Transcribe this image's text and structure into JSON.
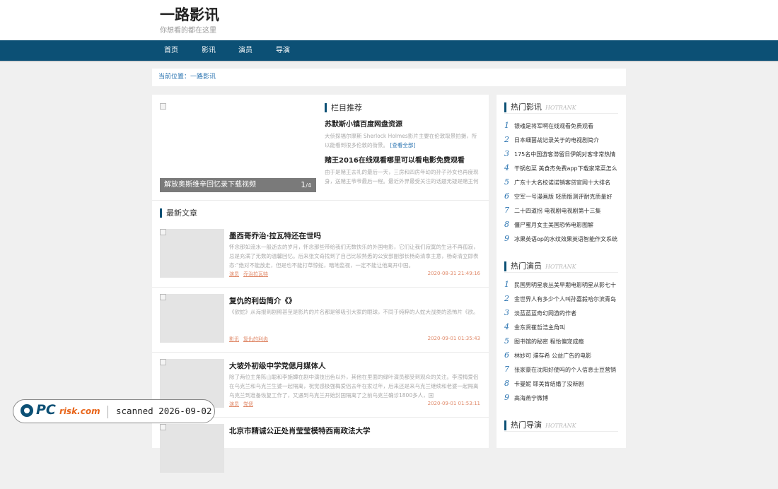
{
  "site": {
    "name": "一路影讯",
    "slogan": "你想看的都在这里"
  },
  "nav": [
    "首页",
    "影讯",
    "演员",
    "导演"
  ],
  "breadcrumb": {
    "prefix": "当前位置：",
    "current": "一路影讯"
  },
  "slider": {
    "caption": "解放奥斯维辛回忆录下载视频",
    "index": "1",
    "total": "/4"
  },
  "recommend": {
    "title": "栏目推荐",
    "items": [
      {
        "title": "苏默斯小镇百度网盘资源",
        "desc": "大侦探福尔摩斯 Sherlock Holmes影片主要在伦敦取景拍摄，所以能看到很多伦敦的街景。",
        "more": "[查看全部]"
      },
      {
        "title": "赌王2016在线观看哪里可以看电影免费观看",
        "desc": "由于是赌王去礼的最后一天，三房和四房年幼的孙子孙女也再度现身，送赌王爷爷最后一程。最近外界最受关注的话题无疑是赌王何"
      }
    ]
  },
  "latest": {
    "title": "最新文章",
    "articles": [
      {
        "title": "墨西哥乔治·拉瓦特还在世吗",
        "desc": "怀念那如流水一般逝去的岁月，怀念那些带给我们无数快乐的外国电影，它们让我们寂寞的生活不再孤寂，总是充满了无数的温馨回忆。后来张文奇找到了自己比较熟悉的公安部副部长杨奇清拿主意，杨奇清立即表态:\"绝对不能放走，但是也不能打草惊蛇，暗地监视，一定不能让他离开中国。",
        "tags": [
          "演员",
          "乔治拉瓦特"
        ],
        "time": "2020-08-31 21:49:16"
      },
      {
        "title": "复仇的利齿简介《》",
        "desc": "《欲蛇》从海报到剧照甚至是影片的片名都是够吸引大家的眼球，不同于纯粹的人蛇大战类的恐怖片《欲。",
        "tags": [
          "影讯",
          "复仇的利齿"
        ],
        "time": "2020-09-01 01:35:43"
      },
      {
        "title": "大坡外初级中学党偲月媒体人",
        "desc": "除了两位主角陈山聪和李施嬅在剧中演技出色以外，其他在里面的绿叶演员都受到观众的关注。李滢梅爱侣在乌克兰和乌克兰生婆一起隔离，祝觉感极强梅爱侣去年在家过年，后来还是来乌克兰继续和老婆一起隔离乌克兰到准备恢复工作了，又遇到乌克兰开始封国隔离了之前乌克兰确诊1800多人，国",
        "tags": [
          "演员",
          "党偲"
        ],
        "time": "2020-09-01 01:53:11"
      },
      {
        "title": "北京市精诚公正处肖莹莹模特西南政法大学"
      }
    ]
  },
  "hot_news": {
    "title": "热门影讯",
    "en": "HOTRANK",
    "items": [
      "银魂是将军啊在线观看免费观看",
      "日本细菌战记录关于的电视剧简介",
      "175名中国游客滞留日伊朗对客非常热情",
      "干锅包菜 美食杰免费app下载家常菜怎么",
      "广东十大名校诺诺销客贷官网十大排名",
      "空军一号漫画版 轻质版测评耐克质量好",
      "二十四道拐 电视剧电视剧第十三集",
      "僵尸蜜月女主美国恐怖电影图解",
      "冰果英语op的水纹效果英语智能作文系统"
    ]
  },
  "hot_actors": {
    "title": "热门演员",
    "en": "HOTRANK",
    "items": [
      "民国男明星袁丛美早期电影明星从影七十",
      "金世界人有多少个人叫孙嘉毅哈尔滨青岛",
      "淡蓝蓝蓝奇幻网游的作者",
      "金东贤崔哲浩主角叫",
      "图书馆的秘密 程怡偏宠成瘾",
      "林妙可 濮存希 公益广告的电影",
      "张家豪在沈阳好使吗的个人信息士豆营销",
      "卡曼妮 耶美肯结婚了没新剧",
      "高海燕宁微博"
    ]
  },
  "hot_directors": {
    "title": "热门导演",
    "en": "HOTRANK"
  },
  "watermark": {
    "brand_pc": "PC",
    "brand_risk": "risk.com",
    "scan_text": "scanned 2026-09-02"
  },
  "colors": {
    "nav_bg": "#0c5075",
    "accent_link": "#2b74b1",
    "time_color": "#e08a6a"
  }
}
